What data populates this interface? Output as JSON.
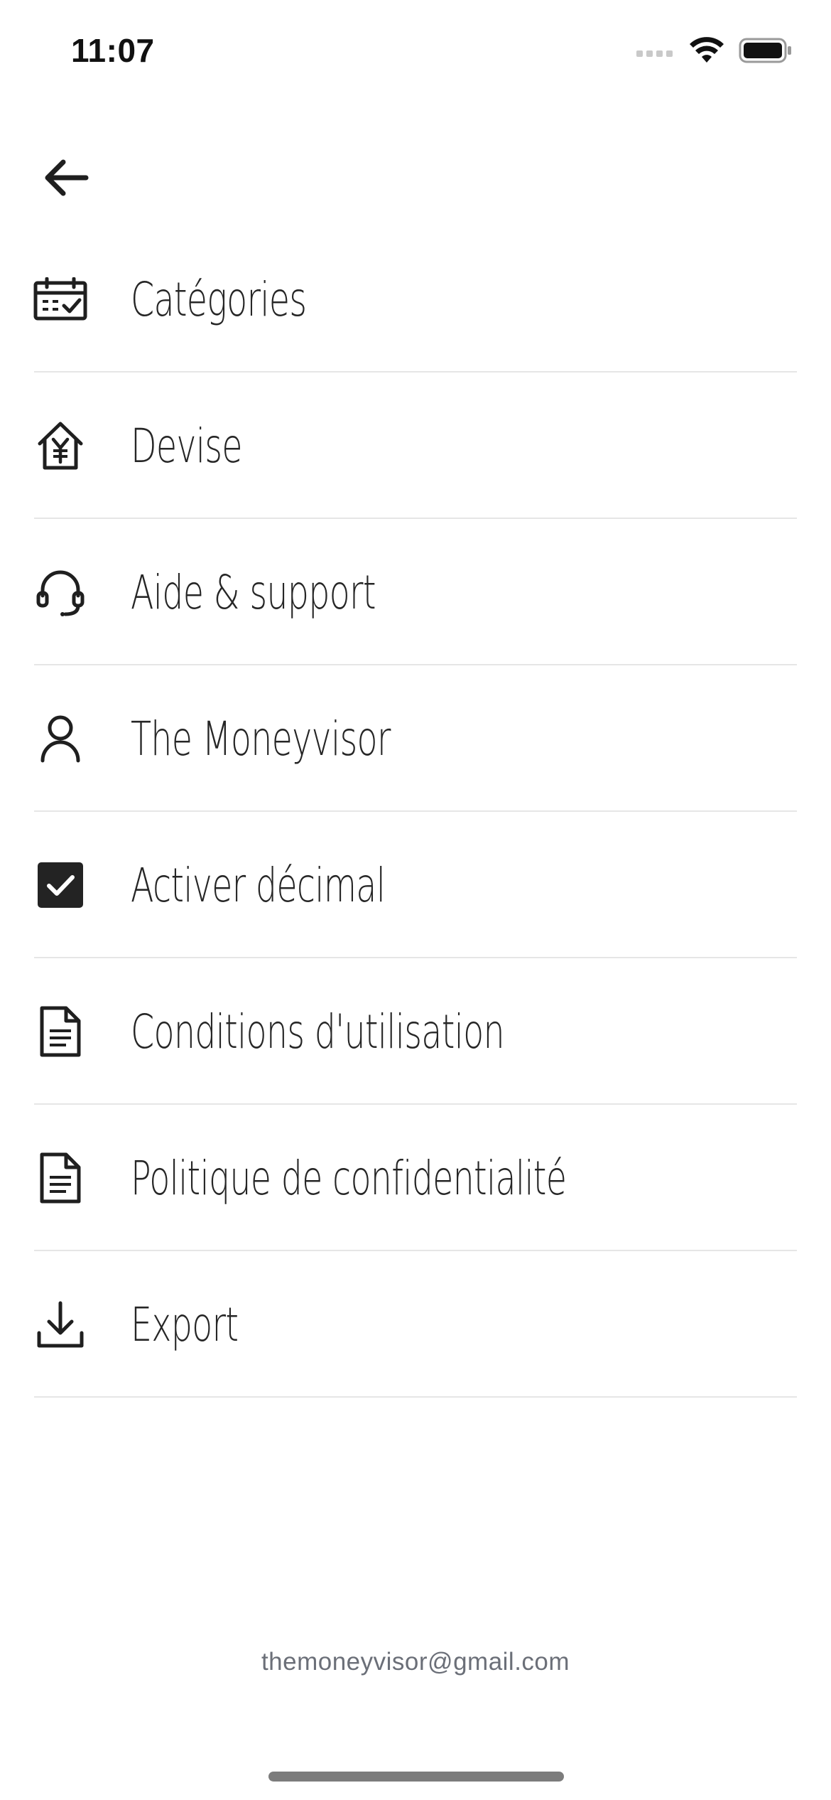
{
  "status_bar": {
    "time": "11:07"
  },
  "header": {
    "back_icon": "arrow-left-icon"
  },
  "menu": {
    "items": [
      {
        "label": "Catégories",
        "icon": "calendar-check-icon"
      },
      {
        "label": "Devise",
        "icon": "house-yen-icon"
      },
      {
        "label": "Aide & support",
        "icon": "headset-icon"
      },
      {
        "label": "The Moneyvisor",
        "icon": "user-icon"
      },
      {
        "label": "Activer décimal",
        "icon": "checkbox-checked-icon",
        "checked": true
      },
      {
        "label": "Conditions d'utilisation",
        "icon": "document-icon"
      },
      {
        "label": "Politique de confidentialité",
        "icon": "document-icon"
      },
      {
        "label": "Export",
        "icon": "download-icon"
      }
    ]
  },
  "footer": {
    "email": "themoneyvisor@gmail.com"
  }
}
